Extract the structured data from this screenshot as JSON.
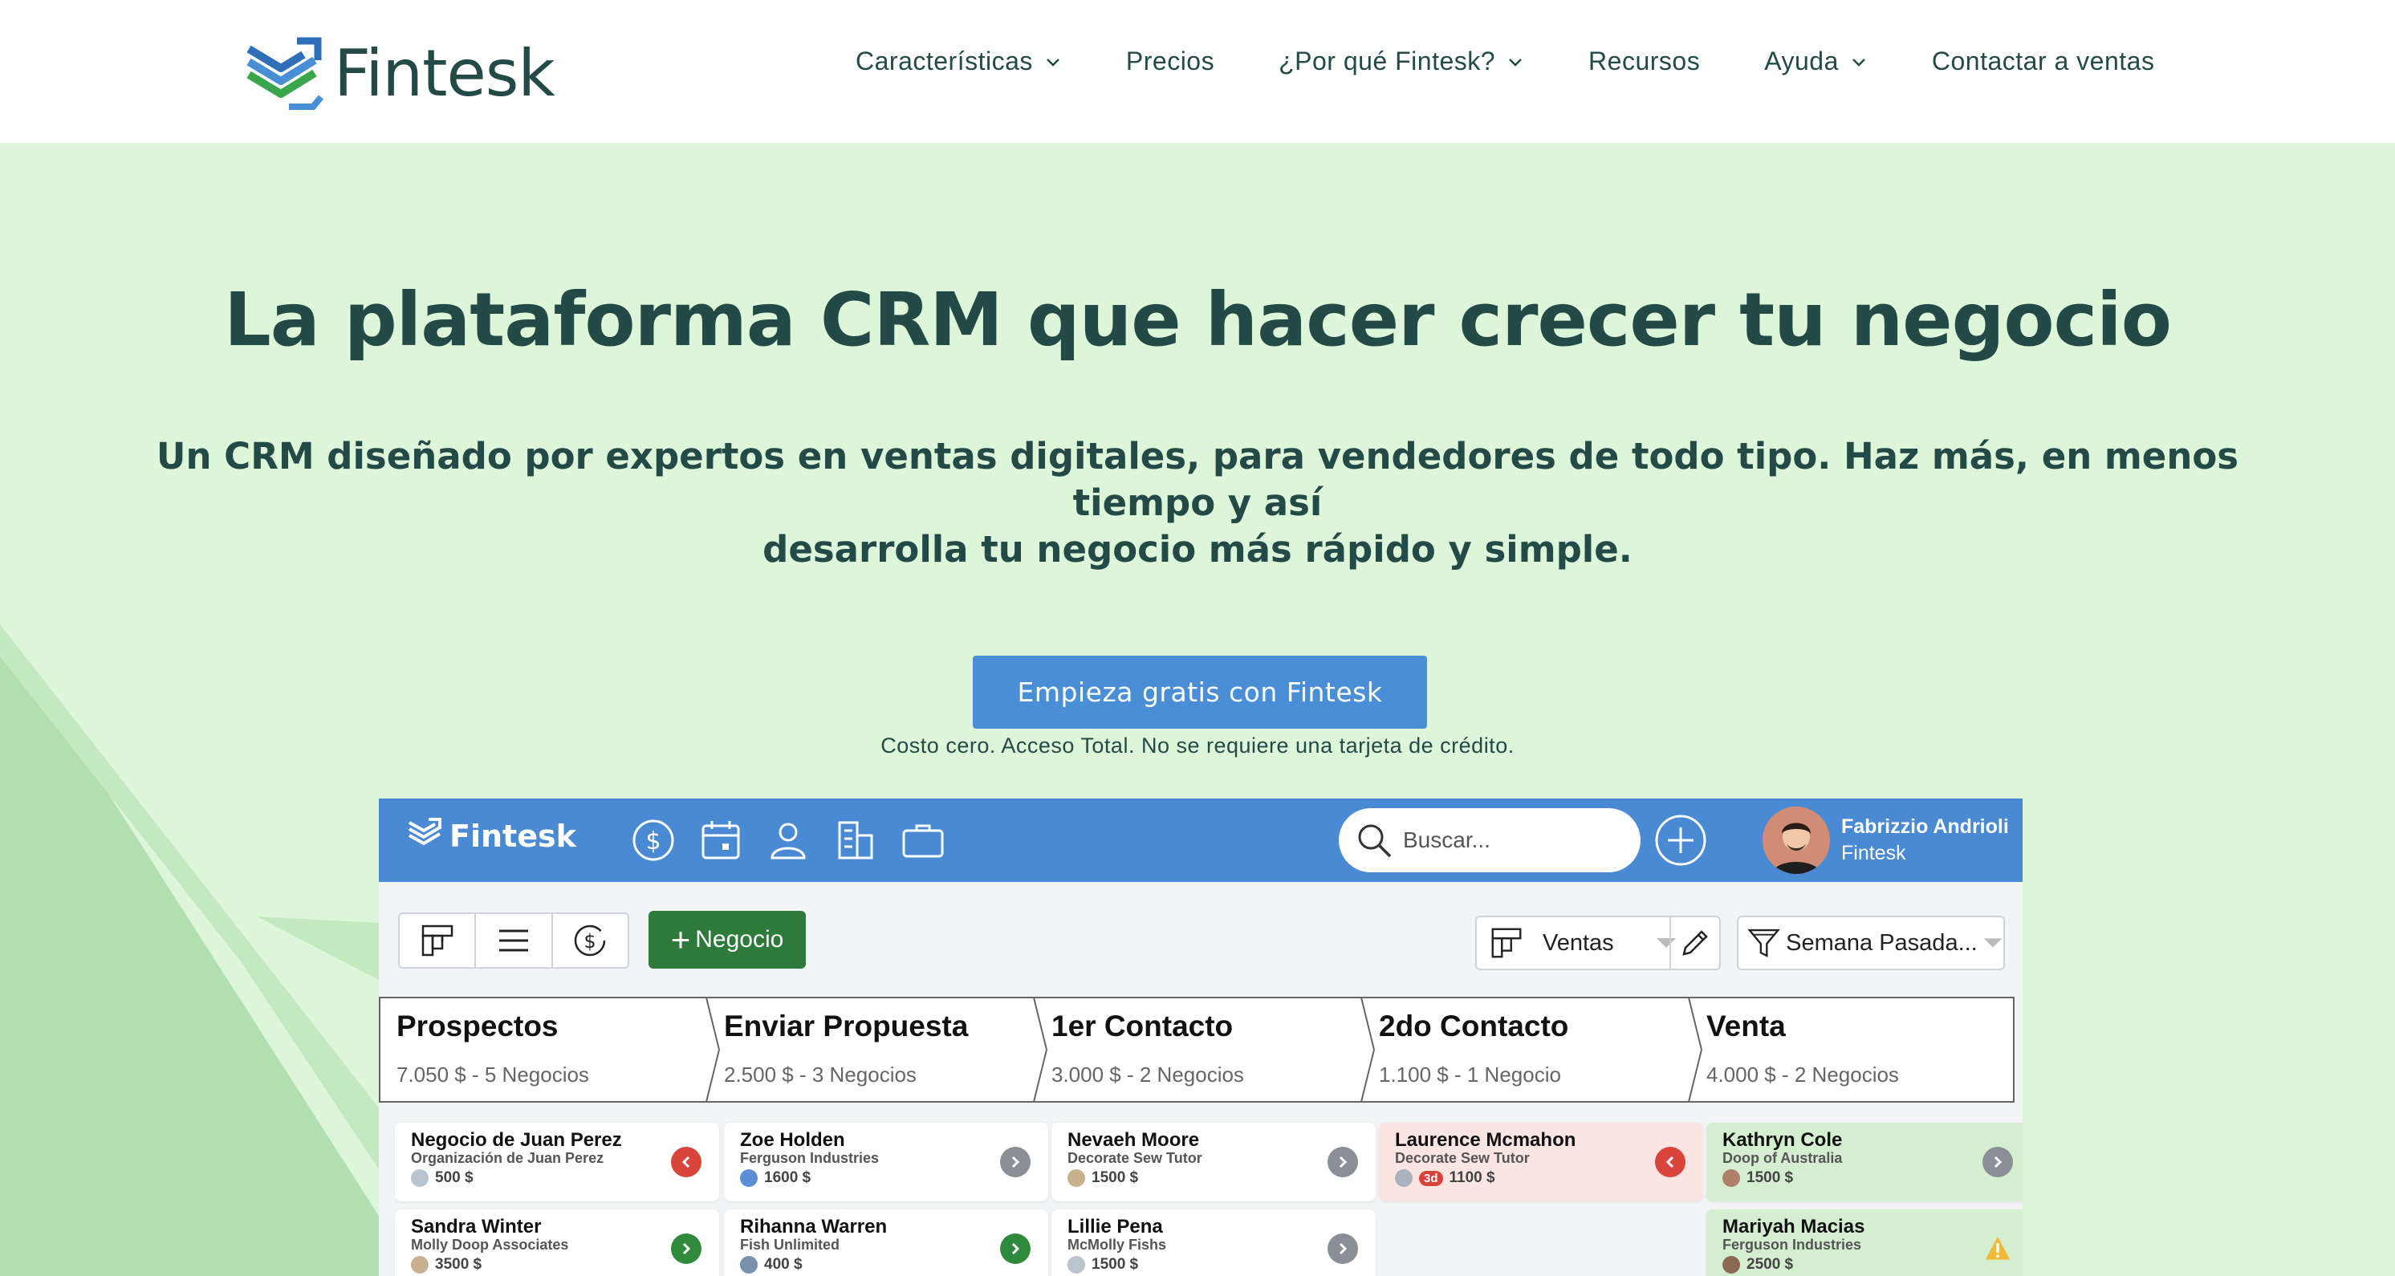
{
  "brand": {
    "name": "Fintesk"
  },
  "nav": {
    "items": [
      {
        "label": "Características",
        "has_dropdown": true
      },
      {
        "label": "Precios",
        "has_dropdown": false
      },
      {
        "label": "¿Por qué Fintesk?",
        "has_dropdown": true
      },
      {
        "label": "Recursos",
        "has_dropdown": false
      },
      {
        "label": "Ayuda",
        "has_dropdown": true
      },
      {
        "label": "Contactar a ventas",
        "has_dropdown": false
      }
    ]
  },
  "hero": {
    "title": "La plataforma CRM que hacer crecer tu negocio",
    "subtitle_line1": "Un CRM diseñado por expertos en ventas digitales, para vendedores de todo tipo. Haz más, en menos tiempo y así",
    "subtitle_line2": "desarrolla tu negocio más rápido y simple.",
    "cta_label": "Empieza gratis con Fintesk",
    "cta_note": "Costo cero. Acceso Total. No se requiere una tarjeta de crédito."
  },
  "app": {
    "brand": "Fintesk",
    "icons": [
      "dollar-icon",
      "calendar-icon",
      "person-icon",
      "building-icon",
      "briefcase-icon"
    ],
    "search_placeholder": "Buscar...",
    "user": {
      "name": "Fabrizzio Andrioli",
      "org": "Fintesk"
    },
    "toolbar": {
      "new_deal_label": "Negocio",
      "pipeline": "Ventas",
      "period": "Semana Pasada..."
    },
    "stages": [
      {
        "name": "Prospectos",
        "summary": "7.050 $ - 5 Negocios"
      },
      {
        "name": "Enviar Propuesta",
        "summary": "2.500 $ - 3 Negocios"
      },
      {
        "name": "1er Contacto",
        "summary": "3.000 $ - 2 Negocios"
      },
      {
        "name": "2do Contacto",
        "summary": "1.100 $ - 1 Negocio"
      },
      {
        "name": "Venta",
        "summary": "4.000 $ - 2 Negocios"
      }
    ],
    "cards": [
      {
        "name": "Negocio de Juan Perez",
        "org": "Organización de Juan Perez",
        "amount": "500 $",
        "badge": "",
        "status": "red",
        "tint": "white"
      },
      {
        "name": "Zoe Holden",
        "org": "Ferguson Industries",
        "amount": "1600 $",
        "badge": "",
        "status": "gray",
        "tint": "white"
      },
      {
        "name": "Nevaeh Moore",
        "org": "Decorate Sew Tutor",
        "amount": "1500 $",
        "badge": "",
        "status": "gray",
        "tint": "white"
      },
      {
        "name": "Laurence Mcmahon",
        "org": "Decorate Sew Tutor",
        "amount": "1100 $",
        "badge": "3d",
        "status": "red",
        "tint": "pink"
      },
      {
        "name": "Kathryn Cole",
        "org": "Doop of Australia",
        "amount": "1500 $",
        "badge": "",
        "status": "gray",
        "tint": "green"
      },
      {
        "name": "Sandra Winter",
        "org": "Molly Doop Associates",
        "amount": "3500 $",
        "badge": "",
        "status": "green",
        "tint": "white"
      },
      {
        "name": "Rihanna Warren",
        "org": "Fish Unlimited",
        "amount": "400 $",
        "badge": "",
        "status": "green",
        "tint": "white"
      },
      {
        "name": "Lillie Pena",
        "org": "McMolly Fishs",
        "amount": "1500 $",
        "badge": "",
        "status": "gray",
        "tint": "white"
      },
      {
        "name": "Mariyah Macias",
        "org": "Ferguson Industries",
        "amount": "2500 $",
        "badge": "",
        "status": "warn",
        "tint": "green"
      }
    ]
  },
  "colors": {
    "page_bg": "#ddf5d8",
    "text_dark": "#234a47",
    "cta_blue": "#4a8fd5",
    "app_header": "#4a8ad4",
    "new_deal_green": "#2e7a3a"
  }
}
